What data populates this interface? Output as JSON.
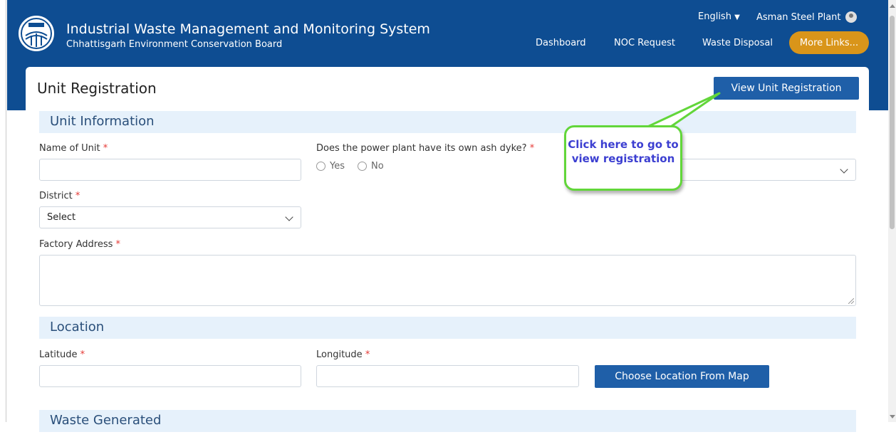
{
  "header": {
    "title": "Industrial Waste Management and Monitoring System",
    "subtitle": "Chhattisgarh Environment Conservation Board",
    "language": "English",
    "user": "Asman Steel Plant",
    "nav": [
      "Dashboard",
      "NOC Request",
      "Waste Disposal"
    ],
    "more_links": "More Links...",
    "brand_color": "#0e4d92",
    "more_links_color": "#d9951a"
  },
  "page": {
    "title": "Unit Registration",
    "view_button": "View Unit Registration"
  },
  "sections": {
    "unit_info": "Unit Information",
    "location": "Location",
    "waste": "Waste Generated"
  },
  "fields": {
    "name_of_unit": "Name of Unit",
    "ash_dyke": "Does the power plant have its own ash dyke?",
    "yes": "Yes",
    "no": "No",
    "district": "District",
    "district_value": "Select",
    "factory_address": "Factory Address",
    "latitude": "Latitude",
    "longitude": "Longitude",
    "required_marker": "*"
  },
  "buttons": {
    "choose_location": "Choose Location From Map"
  },
  "callout": {
    "text": "Click here to go to view registration",
    "border_color": "#62d63a",
    "text_color": "#3c3fd1"
  },
  "icons": [
    "logo-icon",
    "chevron-down-icon",
    "user-icon",
    "radio-icon"
  ]
}
